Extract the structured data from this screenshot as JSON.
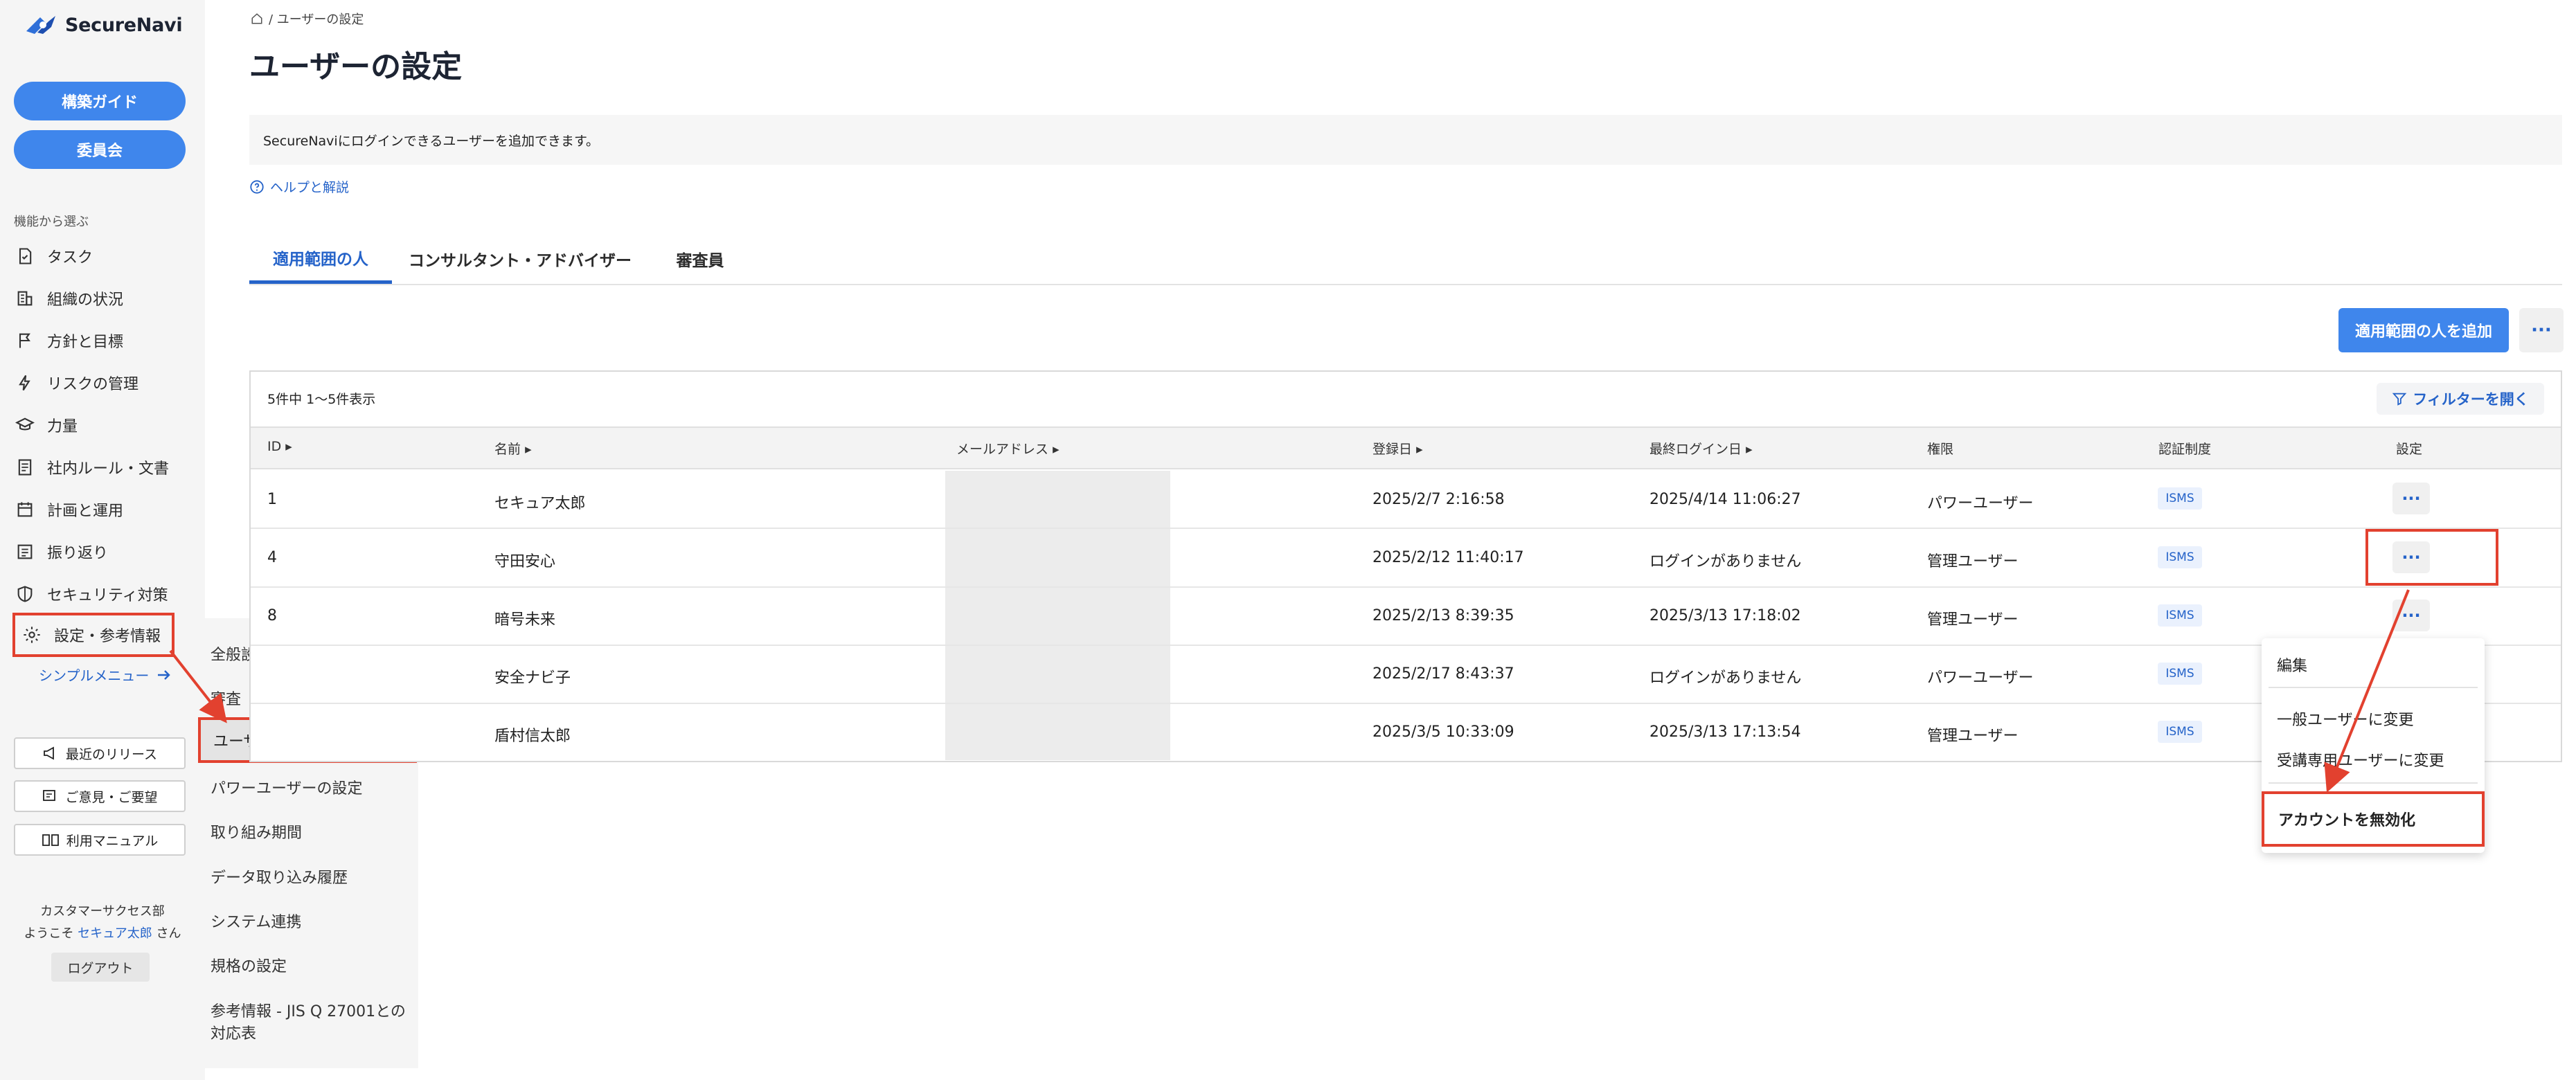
{
  "brand": {
    "name": "SecureNavi",
    "logo_color": "#2f6fd8"
  },
  "sidebar": {
    "pill_buttons": [
      "構築ガイド",
      "委員会"
    ],
    "section_label": "機能から選ぶ",
    "items": [
      {
        "label": "タスク",
        "icon": "task-icon"
      },
      {
        "label": "組織の状況",
        "icon": "building-icon"
      },
      {
        "label": "方針と目標",
        "icon": "flag-icon"
      },
      {
        "label": "リスクの管理",
        "icon": "bolt-icon"
      },
      {
        "label": "力量",
        "icon": "graduation-cap-icon"
      },
      {
        "label": "社内ルール・文書",
        "icon": "document-icon"
      },
      {
        "label": "計画と運用",
        "icon": "calendar-icon"
      },
      {
        "label": "振り返り",
        "icon": "review-icon"
      },
      {
        "label": "セキュリティ対策",
        "icon": "shield-icon"
      },
      {
        "label": "設定・参考情報",
        "icon": "gear-icon"
      }
    ],
    "simple_menu": "シンプルメニュー",
    "utility_buttons": [
      {
        "label": "最近のリリース",
        "icon": "megaphone-icon"
      },
      {
        "label": "ご意見・ご要望",
        "icon": "feedback-icon"
      },
      {
        "label": "利用マニュアル",
        "icon": "book-icon"
      }
    ],
    "department": "カスタマーサクセス部",
    "welcome_prefix": "ようこそ ",
    "welcome_name": "セキュア太郎",
    "welcome_suffix": " さん",
    "logout": "ログアウト"
  },
  "submenu": {
    "items": [
      "全般設定",
      "審査",
      "ユーザーの設定",
      "パワーユーザーの設定",
      "取り組み期間",
      "データ取り込み履歴",
      "システム連携",
      "規格の設定",
      "参考情報 - JIS Q 27001との",
      "対応表"
    ]
  },
  "header": {
    "breadcrumb": "/ ユーザーの設定",
    "title": "ユーザーの設定",
    "info": "SecureNaviにログインできるユーザーを追加できます。",
    "help": "ヘルプと解説"
  },
  "tabs": [
    "適用範囲の人",
    "コンサルタント・アドバイザー",
    "審査員"
  ],
  "toolbar": {
    "add_button": "適用範囲の人を追加",
    "more": "···"
  },
  "table": {
    "count_text": "5件中  1〜5件表示",
    "filter_button": "フィルターを開く",
    "columns": [
      "ID",
      "名前",
      "メールアドレス",
      "登録日",
      "最終ログイン日",
      "権限",
      "認証制度",
      "設定"
    ],
    "rows": [
      {
        "id": "1",
        "name": "セキュア太郎",
        "registered": "2025/2/7 2:16:58",
        "last_login": "2025/4/14 11:06:27",
        "role": "パワーユーザー",
        "cert": "ISMS"
      },
      {
        "id": "4",
        "name": "守田安心",
        "registered": "2025/2/12 11:40:17",
        "last_login": "ログインがありません",
        "role": "管理ユーザー",
        "cert": "ISMS"
      },
      {
        "id": "8",
        "name": "暗号未来",
        "registered": "2025/2/13 8:39:35",
        "last_login": "2025/3/13 17:18:02",
        "role": "管理ユーザー",
        "cert": "ISMS"
      },
      {
        "id": "",
        "name": "安全ナビ子",
        "registered": "2025/2/17 8:43:37",
        "last_login": "ログインがありません",
        "role": "パワーユーザー",
        "cert": "ISMS"
      },
      {
        "id": "",
        "name": "盾村信太郎",
        "registered": "2025/3/5 10:33:09",
        "last_login": "2025/3/13 17:13:54",
        "role": "管理ユーザー",
        "cert": "ISMS"
      }
    ],
    "row_action": "···"
  },
  "dropdown": {
    "items": [
      "編集",
      "一般ユーザーに変更",
      "受講専用ユーザーに変更",
      "アカウントを無効化"
    ]
  },
  "colors": {
    "accent": "#3f86ec",
    "link": "#2563c9",
    "highlight": "#e2412f"
  }
}
